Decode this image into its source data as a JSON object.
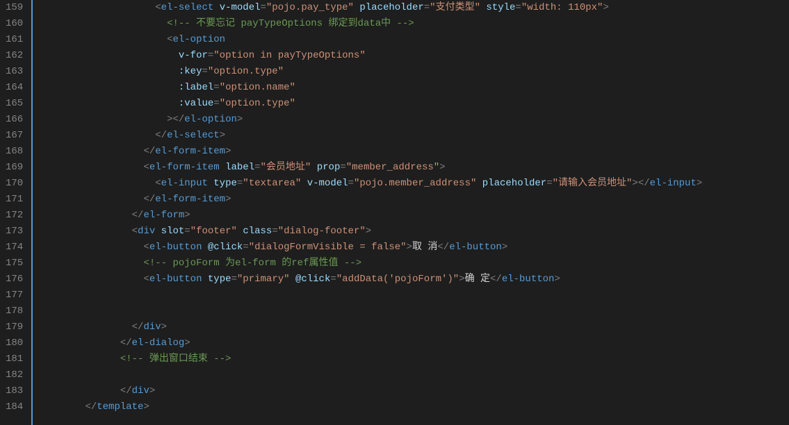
{
  "lines": [
    {
      "n": 159,
      "indent": 10,
      "tokens": [
        {
          "c": "p",
          "t": "<"
        },
        {
          "c": "tg",
          "t": "el-select"
        },
        {
          "c": "tx",
          "t": " "
        },
        {
          "c": "an",
          "t": "v-model"
        },
        {
          "c": "p",
          "t": "="
        },
        {
          "c": "av",
          "t": "\"pojo.pay_type\""
        },
        {
          "c": "tx",
          "t": " "
        },
        {
          "c": "an",
          "t": "placeholder"
        },
        {
          "c": "p",
          "t": "="
        },
        {
          "c": "av",
          "t": "\"支付类型\""
        },
        {
          "c": "tx",
          "t": " "
        },
        {
          "c": "an",
          "t": "style"
        },
        {
          "c": "p",
          "t": "="
        },
        {
          "c": "av",
          "t": "\"width: 110px\""
        },
        {
          "c": "p",
          "t": ">"
        }
      ]
    },
    {
      "n": 160,
      "indent": 11,
      "tokens": [
        {
          "c": "cm",
          "t": "<!-- 不要忘记 payTypeOptions 绑定到data中 -->"
        }
      ]
    },
    {
      "n": 161,
      "indent": 11,
      "tokens": [
        {
          "c": "p",
          "t": "<"
        },
        {
          "c": "tg",
          "t": "el-option"
        }
      ]
    },
    {
      "n": 162,
      "indent": 12,
      "tokens": [
        {
          "c": "an",
          "t": "v-for"
        },
        {
          "c": "p",
          "t": "="
        },
        {
          "c": "av",
          "t": "\"option in payTypeOptions\""
        }
      ]
    },
    {
      "n": 163,
      "indent": 12,
      "tokens": [
        {
          "c": "an",
          "t": ":key"
        },
        {
          "c": "p",
          "t": "="
        },
        {
          "c": "av",
          "t": "\"option.type\""
        }
      ]
    },
    {
      "n": 164,
      "indent": 12,
      "tokens": [
        {
          "c": "an",
          "t": ":label"
        },
        {
          "c": "p",
          "t": "="
        },
        {
          "c": "av",
          "t": "\"option.name\""
        }
      ]
    },
    {
      "n": 165,
      "indent": 12,
      "tokens": [
        {
          "c": "an",
          "t": ":value"
        },
        {
          "c": "p",
          "t": "="
        },
        {
          "c": "av",
          "t": "\"option.type\""
        }
      ]
    },
    {
      "n": 166,
      "indent": 11,
      "tokens": [
        {
          "c": "p",
          "t": "></"
        },
        {
          "c": "tg",
          "t": "el-option"
        },
        {
          "c": "p",
          "t": ">"
        }
      ]
    },
    {
      "n": 167,
      "indent": 10,
      "tokens": [
        {
          "c": "p",
          "t": "</"
        },
        {
          "c": "tg",
          "t": "el-select"
        },
        {
          "c": "p",
          "t": ">"
        }
      ]
    },
    {
      "n": 168,
      "indent": 9,
      "tokens": [
        {
          "c": "p",
          "t": "</"
        },
        {
          "c": "tg",
          "t": "el-form-item"
        },
        {
          "c": "p",
          "t": ">"
        }
      ]
    },
    {
      "n": 169,
      "indent": 9,
      "tokens": [
        {
          "c": "p",
          "t": "<"
        },
        {
          "c": "tg",
          "t": "el-form-item"
        },
        {
          "c": "tx",
          "t": " "
        },
        {
          "c": "an",
          "t": "label"
        },
        {
          "c": "p",
          "t": "="
        },
        {
          "c": "av",
          "t": "\"会员地址\""
        },
        {
          "c": "tx",
          "t": " "
        },
        {
          "c": "an",
          "t": "prop"
        },
        {
          "c": "p",
          "t": "="
        },
        {
          "c": "av",
          "t": "\"member_address\""
        },
        {
          "c": "p",
          "t": ">"
        }
      ]
    },
    {
      "n": 170,
      "indent": 10,
      "tokens": [
        {
          "c": "p",
          "t": "<"
        },
        {
          "c": "tg",
          "t": "el-input"
        },
        {
          "c": "tx",
          "t": " "
        },
        {
          "c": "an",
          "t": "type"
        },
        {
          "c": "p",
          "t": "="
        },
        {
          "c": "av",
          "t": "\"textarea\""
        },
        {
          "c": "tx",
          "t": " "
        },
        {
          "c": "an",
          "t": "v-model"
        },
        {
          "c": "p",
          "t": "="
        },
        {
          "c": "av",
          "t": "\"pojo.member_address\""
        },
        {
          "c": "tx",
          "t": " "
        },
        {
          "c": "an",
          "t": "placeholder"
        },
        {
          "c": "p",
          "t": "="
        },
        {
          "c": "av",
          "t": "\"请输入会员地址\""
        },
        {
          "c": "p",
          "t": "></"
        },
        {
          "c": "tg",
          "t": "el-input"
        },
        {
          "c": "p",
          "t": ">"
        }
      ]
    },
    {
      "n": 171,
      "indent": 9,
      "tokens": [
        {
          "c": "p",
          "t": "</"
        },
        {
          "c": "tg",
          "t": "el-form-item"
        },
        {
          "c": "p",
          "t": ">"
        }
      ]
    },
    {
      "n": 172,
      "indent": 8,
      "tokens": [
        {
          "c": "p",
          "t": "</"
        },
        {
          "c": "tg",
          "t": "el-form"
        },
        {
          "c": "p",
          "t": ">"
        }
      ]
    },
    {
      "n": 173,
      "indent": 8,
      "tokens": [
        {
          "c": "p",
          "t": "<"
        },
        {
          "c": "tg",
          "t": "div"
        },
        {
          "c": "tx",
          "t": " "
        },
        {
          "c": "an",
          "t": "slot"
        },
        {
          "c": "p",
          "t": "="
        },
        {
          "c": "av",
          "t": "\"footer\""
        },
        {
          "c": "tx",
          "t": " "
        },
        {
          "c": "an",
          "t": "class"
        },
        {
          "c": "p",
          "t": "="
        },
        {
          "c": "av",
          "t": "\"dialog-footer\""
        },
        {
          "c": "p",
          "t": ">"
        }
      ]
    },
    {
      "n": 174,
      "indent": 9,
      "tokens": [
        {
          "c": "p",
          "t": "<"
        },
        {
          "c": "tg",
          "t": "el-button"
        },
        {
          "c": "tx",
          "t": " "
        },
        {
          "c": "an",
          "t": "@click"
        },
        {
          "c": "p",
          "t": "="
        },
        {
          "c": "av",
          "t": "\"dialogFormVisible = false\""
        },
        {
          "c": "p",
          "t": ">"
        },
        {
          "c": "tx",
          "t": "取 消"
        },
        {
          "c": "p",
          "t": "</"
        },
        {
          "c": "tg",
          "t": "el-button"
        },
        {
          "c": "p",
          "t": ">"
        }
      ]
    },
    {
      "n": 175,
      "indent": 9,
      "tokens": [
        {
          "c": "cm",
          "t": "<!-- pojoForm 为el-form 的ref属性值 -->"
        }
      ]
    },
    {
      "n": 176,
      "indent": 9,
      "tokens": [
        {
          "c": "p",
          "t": "<"
        },
        {
          "c": "tg",
          "t": "el-button"
        },
        {
          "c": "tx",
          "t": " "
        },
        {
          "c": "an",
          "t": "type"
        },
        {
          "c": "p",
          "t": "="
        },
        {
          "c": "av",
          "t": "\"primary\""
        },
        {
          "c": "tx",
          "t": " "
        },
        {
          "c": "an",
          "t": "@click"
        },
        {
          "c": "p",
          "t": "="
        },
        {
          "c": "av",
          "t": "\"addData('pojoForm')\""
        },
        {
          "c": "p",
          "t": ">"
        },
        {
          "c": "tx",
          "t": "确 定"
        },
        {
          "c": "p",
          "t": "</"
        },
        {
          "c": "tg",
          "t": "el-button"
        },
        {
          "c": "p",
          "t": ">"
        }
      ]
    },
    {
      "n": 177,
      "indent": 0,
      "tokens": []
    },
    {
      "n": 178,
      "indent": 0,
      "tokens": []
    },
    {
      "n": 179,
      "indent": 8,
      "tokens": [
        {
          "c": "p",
          "t": "</"
        },
        {
          "c": "tg",
          "t": "div"
        },
        {
          "c": "p",
          "t": ">"
        }
      ]
    },
    {
      "n": 180,
      "indent": 7,
      "tokens": [
        {
          "c": "p",
          "t": "</"
        },
        {
          "c": "tg",
          "t": "el-dialog"
        },
        {
          "c": "p",
          "t": ">"
        }
      ]
    },
    {
      "n": 181,
      "indent": 7,
      "tokens": [
        {
          "c": "cm",
          "t": "<!-- 弹出窗口结束 -->"
        }
      ]
    },
    {
      "n": 182,
      "indent": 0,
      "tokens": []
    },
    {
      "n": 183,
      "indent": 7,
      "tokens": [
        {
          "c": "p",
          "t": "</"
        },
        {
          "c": "tg",
          "t": "div"
        },
        {
          "c": "p",
          "t": ">"
        }
      ]
    },
    {
      "n": 184,
      "indent": 4,
      "tokens": [
        {
          "c": "p",
          "t": "</"
        },
        {
          "c": "tg",
          "t": "template"
        },
        {
          "c": "p",
          "t": ">"
        }
      ]
    }
  ]
}
